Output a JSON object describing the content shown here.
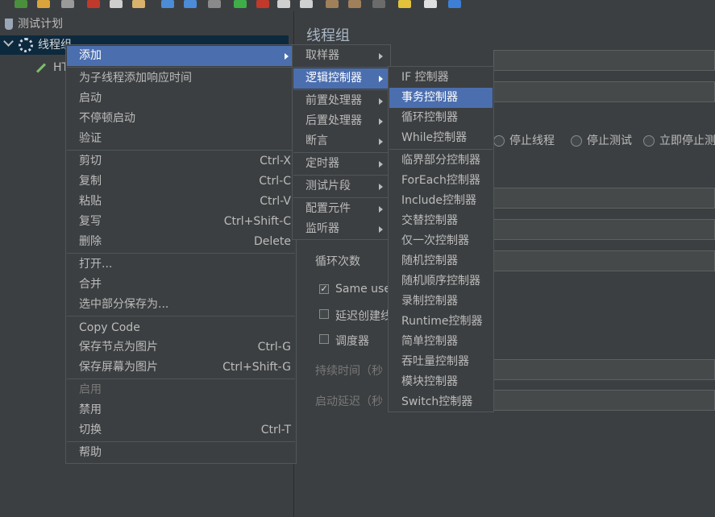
{
  "tree": {
    "root_label": "测试计划",
    "thread_group_label": "线程组",
    "child_label": "HT"
  },
  "panel": {
    "title": "线程组",
    "on_error_options": [
      "停止线程",
      "停止测试",
      "立即停止测"
    ],
    "loop_label": "循环次数",
    "same_user_label": "Same use",
    "delay_label": "延迟创建线",
    "scheduler_label": "调度器",
    "duration_label": "持续时间（秒",
    "startup_delay_label": "启动延迟（秒"
  },
  "context_menu": {
    "items": [
      {
        "label": "添加"
      },
      {
        "label": "为子线程添加响应时间"
      },
      {
        "label": "启动"
      },
      {
        "label": "不停顿启动"
      },
      {
        "label": "验证"
      },
      {
        "label": "剪切",
        "shortcut": "Ctrl-X"
      },
      {
        "label": "复制",
        "shortcut": "Ctrl-C"
      },
      {
        "label": "粘贴",
        "shortcut": "Ctrl-V"
      },
      {
        "label": "复写",
        "shortcut": "Ctrl+Shift-C"
      },
      {
        "label": "删除",
        "shortcut": "Delete"
      },
      {
        "label": "打开..."
      },
      {
        "label": "合并"
      },
      {
        "label": "选中部分保存为..."
      },
      {
        "label": "Copy Code"
      },
      {
        "label": "保存节点为图片",
        "shortcut": "Ctrl-G"
      },
      {
        "label": "保存屏幕为图片",
        "shortcut": "Ctrl+Shift-G"
      },
      {
        "label": "启用"
      },
      {
        "label": "禁用"
      },
      {
        "label": "切换",
        "shortcut": "Ctrl-T"
      },
      {
        "label": "帮助"
      }
    ]
  },
  "add_menu": {
    "items": [
      {
        "label": "取样器"
      },
      {
        "label": "逻辑控制器"
      },
      {
        "label": "前置处理器"
      },
      {
        "label": "后置处理器"
      },
      {
        "label": "断言"
      },
      {
        "label": "定时器"
      },
      {
        "label": "测试片段"
      },
      {
        "label": "配置元件"
      },
      {
        "label": "监听器"
      }
    ]
  },
  "logic_menu": {
    "items": [
      {
        "label": "IF 控制器"
      },
      {
        "label": "事务控制器"
      },
      {
        "label": "循环控制器"
      },
      {
        "label": "While控制器"
      },
      {
        "label": "临界部分控制器"
      },
      {
        "label": "ForEach控制器"
      },
      {
        "label": "Include控制器"
      },
      {
        "label": "交替控制器"
      },
      {
        "label": "仅一次控制器"
      },
      {
        "label": "随机控制器"
      },
      {
        "label": "随机顺序控制器"
      },
      {
        "label": "录制控制器"
      },
      {
        "label": "Runtime控制器"
      },
      {
        "label": "简单控制器"
      },
      {
        "label": "吞吐量控制器"
      },
      {
        "label": "模块控制器"
      },
      {
        "label": "Switch控制器"
      }
    ]
  },
  "colors": {
    "background": "#3c3f41",
    "highlight": "#4b6eaf",
    "tree_selection": "#0d293e"
  }
}
